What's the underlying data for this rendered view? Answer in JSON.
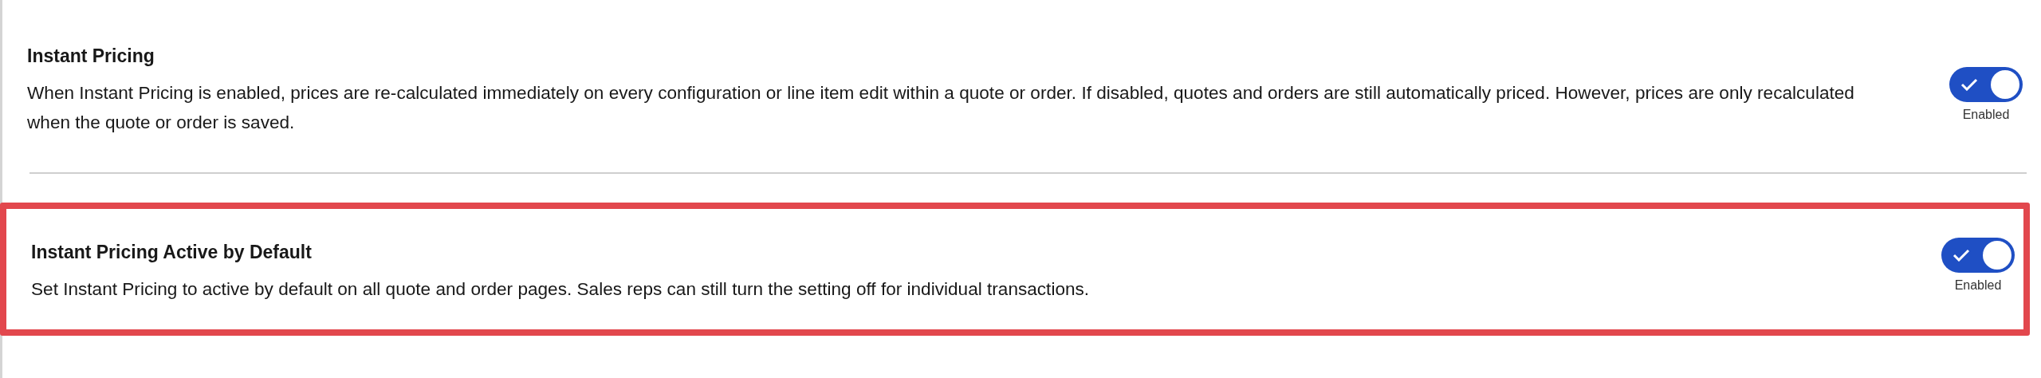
{
  "settings": [
    {
      "title": "Instant Pricing",
      "description": "When Instant Pricing is enabled, prices are re-calculated immediately on every configuration or line item edit within a quote or order. If disabled, quotes and orders are still automatically priced. However, prices are only recalculated when the quote or order is saved.",
      "enabled": true,
      "status": "Enabled",
      "highlighted": false
    },
    {
      "title": "Instant Pricing Active by Default",
      "description": "Set Instant Pricing to active by default on all quote and order pages. Sales reps can still turn the setting off for individual transactions.",
      "enabled": true,
      "status": "Enabled",
      "highlighted": true
    }
  ]
}
